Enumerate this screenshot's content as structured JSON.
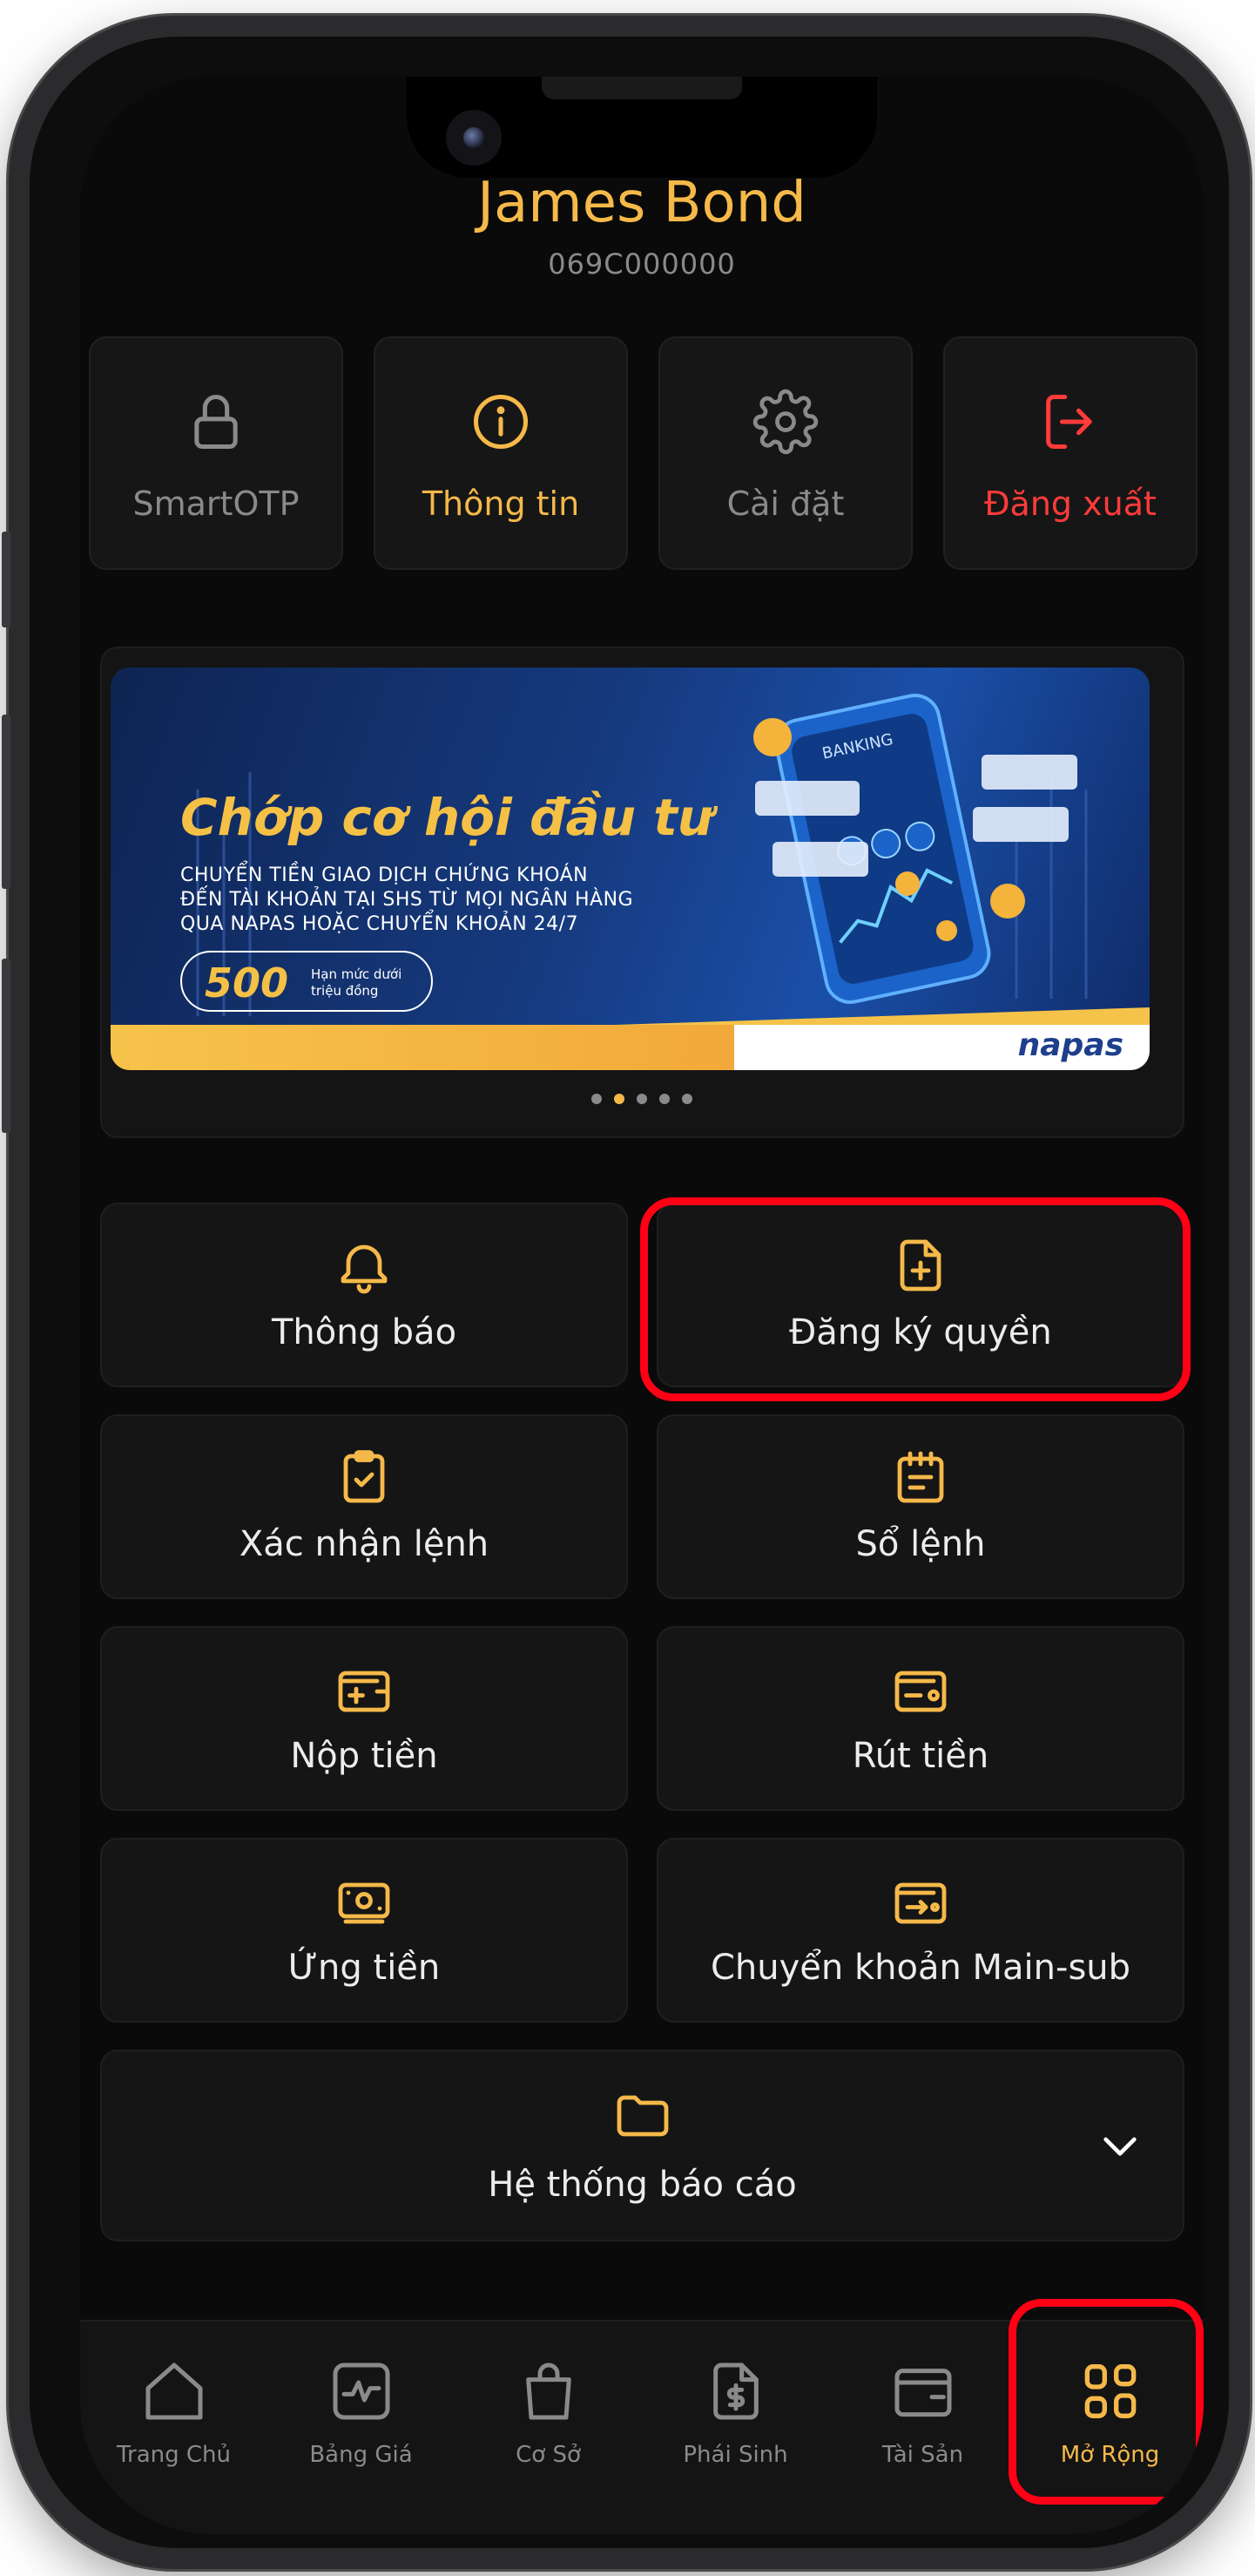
{
  "profile": {
    "name": "James Bond",
    "account_id": "069C000000"
  },
  "quick_actions": [
    {
      "label": "SmartOTP",
      "icon": "lock-icon",
      "color": "#8a8a8a"
    },
    {
      "label": "Thông tin",
      "icon": "info-icon",
      "color": "#f5b94a"
    },
    {
      "label": "Cài đặt",
      "icon": "gear-icon",
      "color": "#8a8a8a"
    },
    {
      "label": "Đăng xuất",
      "icon": "logout-icon",
      "color": "#ff3b3b"
    }
  ],
  "banner": {
    "title": "Chớp cơ hội đầu tư",
    "lines": [
      "CHUYỂN TIỀN GIAO DỊCH CHỨNG KHOÁN",
      "ĐẾN TÀI KHOẢN TẠI SHS TỪ MỌI NGÂN HÀNG",
      "QUA NAPAS HOẶC CHUYỂN KHOẢN 24/7"
    ],
    "limit_value": "500",
    "limit_text": [
      "Hạn mức dưới",
      "triệu đồng"
    ],
    "phone_label": "BANKING",
    "logo": "napas",
    "slides_total": 5,
    "slide_active": 2
  },
  "menu": {
    "items": [
      {
        "label": "Thông báo",
        "icon": "bell-icon"
      },
      {
        "label": "Đăng ký quyền",
        "icon": "file-plus-icon",
        "highlighted": true
      },
      {
        "label": "Xác nhận lệnh",
        "icon": "clipboard-check-icon"
      },
      {
        "label": "Sổ lệnh",
        "icon": "notebook-icon"
      },
      {
        "label": "Nộp tiền",
        "icon": "wallet-plus-icon"
      },
      {
        "label": "Rút tiền",
        "icon": "wallet-minus-icon"
      },
      {
        "label": "Ứng tiền",
        "icon": "cash-icon"
      },
      {
        "label": "Chuyển khoản Main-sub",
        "icon": "wallet-transfer-icon"
      }
    ],
    "reports": {
      "label": "Hệ thống báo cáo",
      "icon": "folder-icon",
      "expand_icon": "chevron-down-icon"
    }
  },
  "tabbar": {
    "active": "Mở Rộng",
    "items": [
      {
        "label": "Trang Chủ",
        "icon": "home-icon"
      },
      {
        "label": "Bảng Giá",
        "icon": "price-board-icon"
      },
      {
        "label": "Cơ Sở",
        "icon": "shopping-bag-icon"
      },
      {
        "label": "Phái Sinh",
        "icon": "document-dollar-icon"
      },
      {
        "label": "Tài Sản",
        "icon": "wallet-icon"
      },
      {
        "label": "Mở Rộng",
        "icon": "grid-icon",
        "highlighted": true
      }
    ]
  },
  "colors": {
    "accent": "#f5b94a",
    "danger": "#ff3b3b",
    "highlight_box": "#ff0015",
    "muted": "#8a8a8a",
    "background": "#0a0a0a"
  }
}
